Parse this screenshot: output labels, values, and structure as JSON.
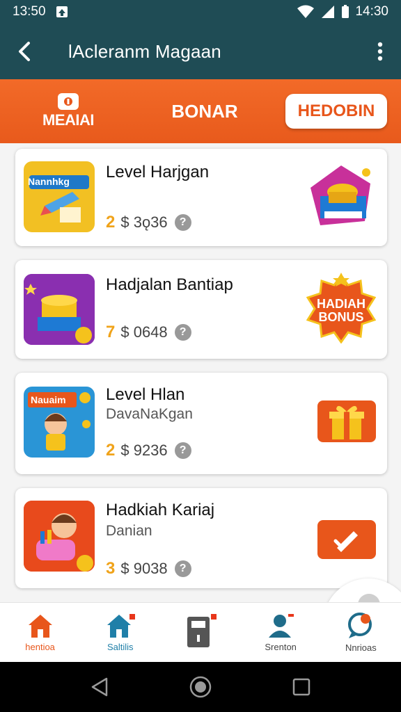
{
  "status_bar": {
    "time_left": "13:50",
    "time_right": "14:30"
  },
  "app_bar": {
    "title": "lAcleranm Magaan"
  },
  "tabs": {
    "menu_label": "MEAIAI",
    "bonar_label": "BONAR",
    "hedobin_label": "HEDOBIN"
  },
  "cards": [
    {
      "title": "Level Harjgan",
      "subtitle": "",
      "level": "2",
      "price": "$ 3ǫ36",
      "thumb_text": "Nannhkg",
      "reward_text": ""
    },
    {
      "title": "Hadjalan Bantiap",
      "subtitle": "",
      "level": "7",
      "price": "$ 0648",
      "thumb_text": "",
      "reward_text": "HADIAH BONUS"
    },
    {
      "title": "Level Hlan",
      "subtitle": "DavaNaKgan",
      "level": "2",
      "price": "$ 9236",
      "thumb_text": "Nauaim",
      "reward_text": ""
    },
    {
      "title": "Hadkiah Kariaj",
      "subtitle": "Danian",
      "level": "3",
      "price": "$ 9038",
      "thumb_text": "",
      "reward_text": ""
    }
  ],
  "bottom_nav": [
    {
      "label": "hentioa",
      "color": "#e8561b"
    },
    {
      "label": "Saltilis",
      "color": "#1f7fa8"
    },
    {
      "label": "",
      "color": "#555555"
    },
    {
      "label": "Srenton",
      "color": "#444444"
    },
    {
      "label": "Nnrioas",
      "color": "#444444"
    }
  ],
  "colors": {
    "primary": "#1f4c55",
    "accent": "#ef6424",
    "level": "#f0a31a"
  }
}
